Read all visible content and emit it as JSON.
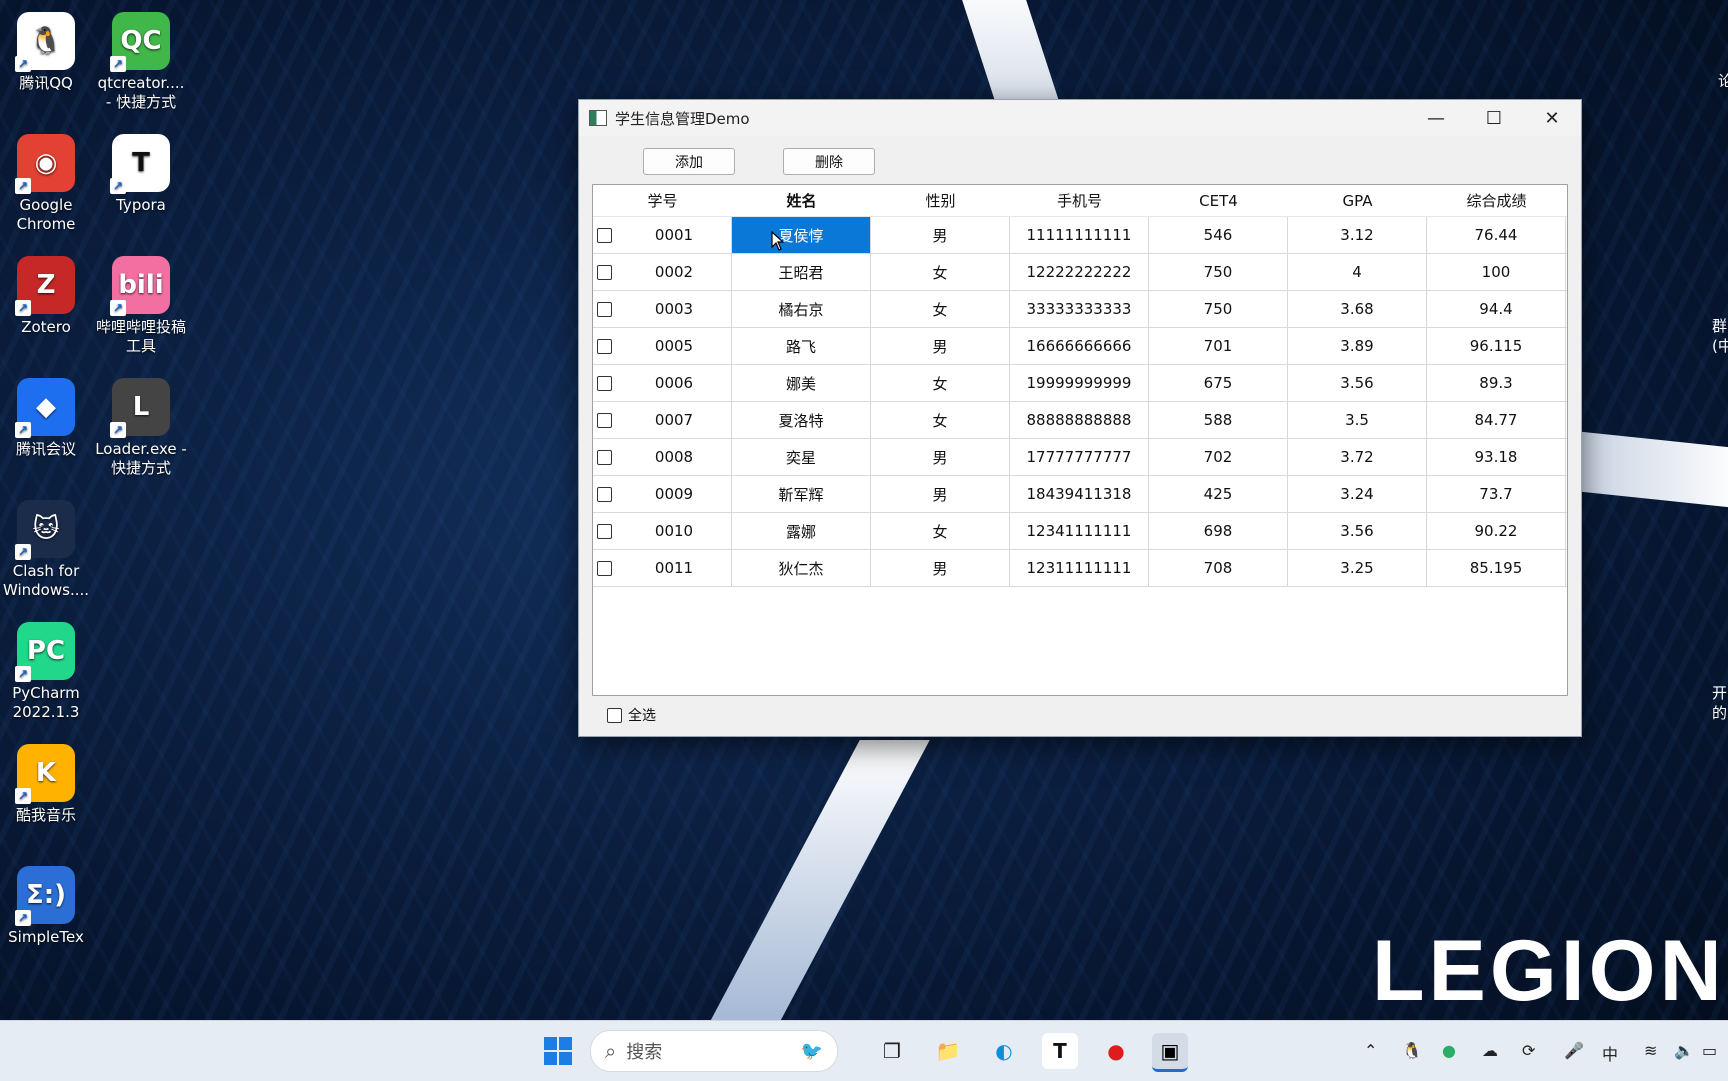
{
  "desktop": {
    "icons": [
      {
        "label": "腾讯QQ",
        "glyph": "🐧",
        "color": "#ffffff"
      },
      {
        "label": "qtcreator.... - 快捷方式",
        "glyph": "QC",
        "color": "#41b649"
      },
      {
        "label": "Google Chrome",
        "glyph": "◉",
        "color": "#e34133"
      },
      {
        "label": "Typora",
        "glyph": "T",
        "color": "#ffffff"
      },
      {
        "label": "Zotero",
        "glyph": "Z",
        "color": "#c62828"
      },
      {
        "label": "哔哩哔哩投稿工具",
        "glyph": "bili",
        "color": "#f36fa1"
      },
      {
        "label": "腾讯会议",
        "glyph": "◆",
        "color": "#1e6ff0"
      },
      {
        "label": "Loader.exe - 快捷方式",
        "glyph": "L",
        "color": "#444444"
      },
      {
        "label": "Clash for Windows....",
        "glyph": "🐱",
        "color": "#1b2c4a"
      },
      {
        "label": "PyCharm 2022.1.3",
        "glyph": "PC",
        "color": "#21d789"
      },
      {
        "label": "酷我音乐",
        "glyph": "K",
        "color": "#ffb300"
      },
      {
        "label": "SimpleTex",
        "glyph": "Σ:)",
        "color": "#2b6fd6"
      }
    ],
    "legion": "LEGION",
    "edge_texts": [
      "论",
      "群",
      "(中",
      "开",
      "的"
    ]
  },
  "window": {
    "title": "学生信息管理Demo",
    "add_label": "添加",
    "delete_label": "删除",
    "select_all_label": "全选",
    "headers": [
      "学号",
      "姓名",
      "性别",
      "手机号",
      "CET4",
      "GPA",
      "综合成绩"
    ],
    "rows": [
      [
        "0001",
        "夏侯惇",
        "男",
        "11111111111",
        "546",
        "3.12",
        "76.44"
      ],
      [
        "0002",
        "王昭君",
        "女",
        "12222222222",
        "750",
        "4",
        "100"
      ],
      [
        "0003",
        "橘右京",
        "女",
        "33333333333",
        "750",
        "3.68",
        "94.4"
      ],
      [
        "0005",
        "路飞",
        "男",
        "16666666666",
        "701",
        "3.89",
        "96.115"
      ],
      [
        "0006",
        "娜美",
        "女",
        "19999999999",
        "675",
        "3.56",
        "89.3"
      ],
      [
        "0007",
        "夏洛特",
        "女",
        "88888888888",
        "588",
        "3.5",
        "84.77"
      ],
      [
        "0008",
        "奕星",
        "男",
        "17777777777",
        "702",
        "3.72",
        "93.18"
      ],
      [
        "0009",
        "靳军辉",
        "男",
        "18439411318",
        "425",
        "3.24",
        "73.7"
      ],
      [
        "0010",
        "露娜",
        "女",
        "12341111111",
        "698",
        "3.56",
        "90.22"
      ],
      [
        "0011",
        "狄仁杰",
        "男",
        "12311111111",
        "708",
        "3.25",
        "85.195"
      ]
    ],
    "selected_cell": {
      "row": 0,
      "col": 1
    }
  },
  "taskbar": {
    "search_placeholder": "搜索",
    "ime": "中"
  }
}
